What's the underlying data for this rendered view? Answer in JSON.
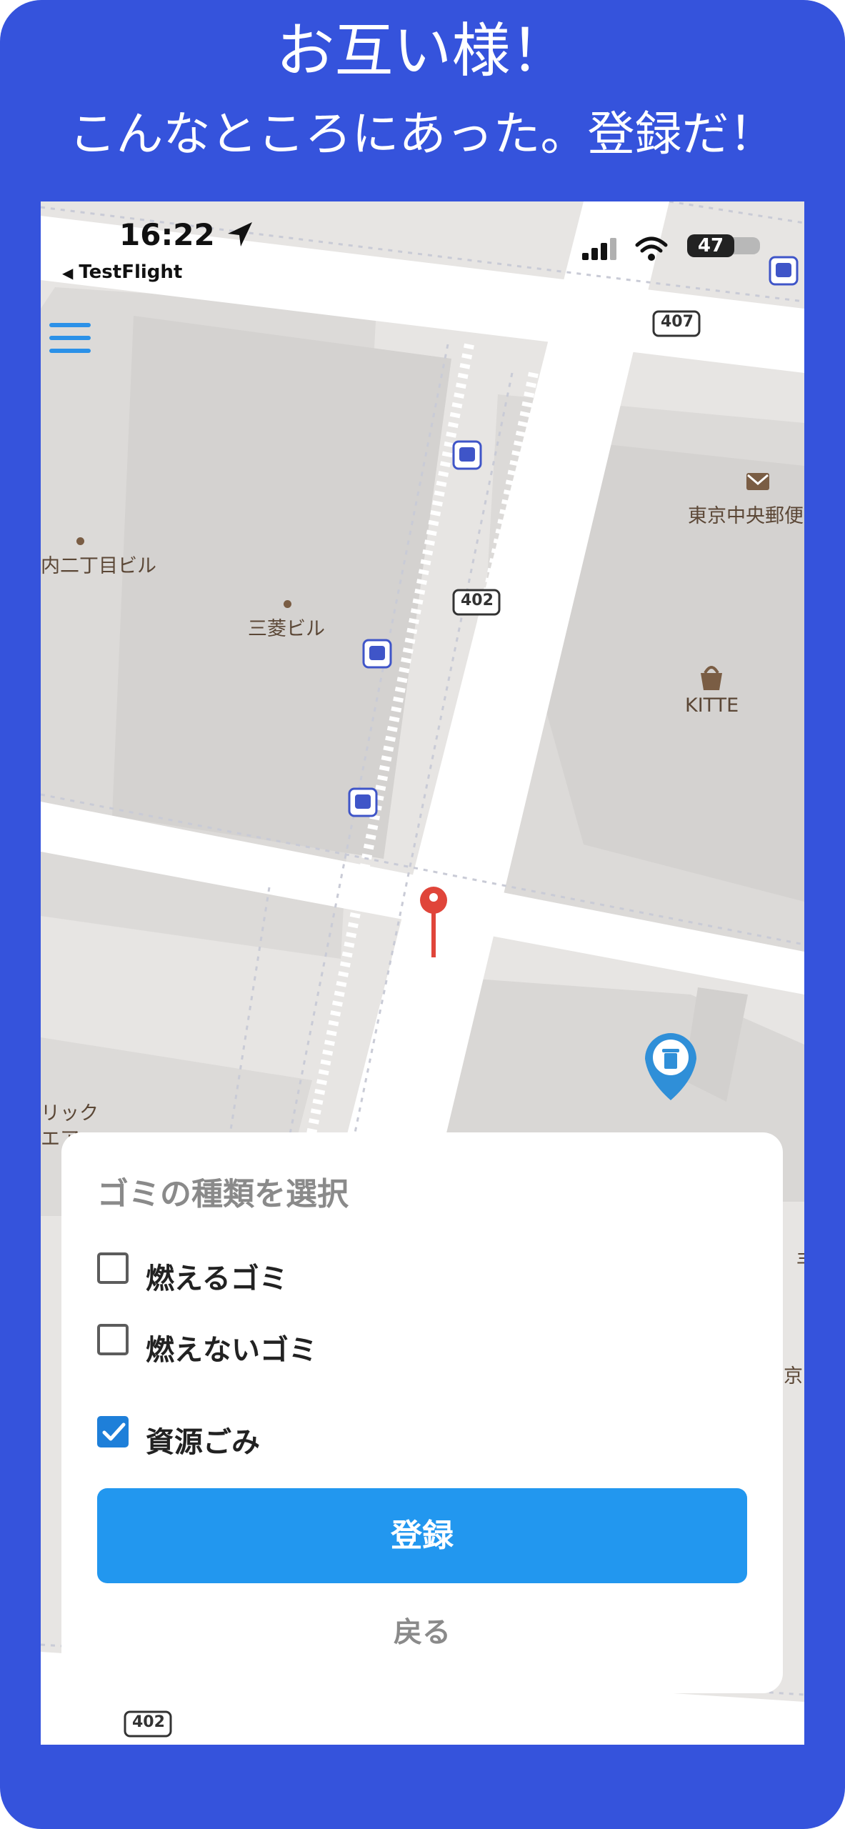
{
  "promo": {
    "headline": "お互い様！",
    "subheadline": "こんなところにあった。登録だ！"
  },
  "status_bar": {
    "time": "16:22",
    "back_app": "TestFlight",
    "battery": "47",
    "icons": [
      "location-arrow-icon",
      "cellular-signal-icon",
      "wifi-icon",
      "battery-icon"
    ]
  },
  "map": {
    "labels": {
      "building_1": "内二丁目ビル",
      "building_2": "三菱ビル",
      "post_office": "東京中央郵便",
      "kitte": "KITTE",
      "partial_left": "リック",
      "partial_left_2": "エア",
      "partial_right": "京",
      "partial_right_2": "丰"
    },
    "route_badges": {
      "top": "407",
      "middle": "402",
      "bottom": "402"
    },
    "icons": [
      "bus-stop-icon",
      "post-office-icon",
      "shopping-bag-icon",
      "red-pin-icon",
      "trash-can-marker-icon"
    ]
  },
  "sheet": {
    "title": "ゴミの種類を選択",
    "options": [
      {
        "label": "燃えるゴミ",
        "checked": false
      },
      {
        "label": "燃えないゴミ",
        "checked": false
      },
      {
        "label": "資源ごみ",
        "checked": true
      }
    ],
    "submit_label": "登録",
    "back_label": "戻る"
  },
  "colors": {
    "frame_blue": "#3553dc",
    "button_blue": "#2297ef",
    "check_blue": "#1e7fd9",
    "pin_red": "#e0453a",
    "marker_blue": "#2f8fd8"
  }
}
